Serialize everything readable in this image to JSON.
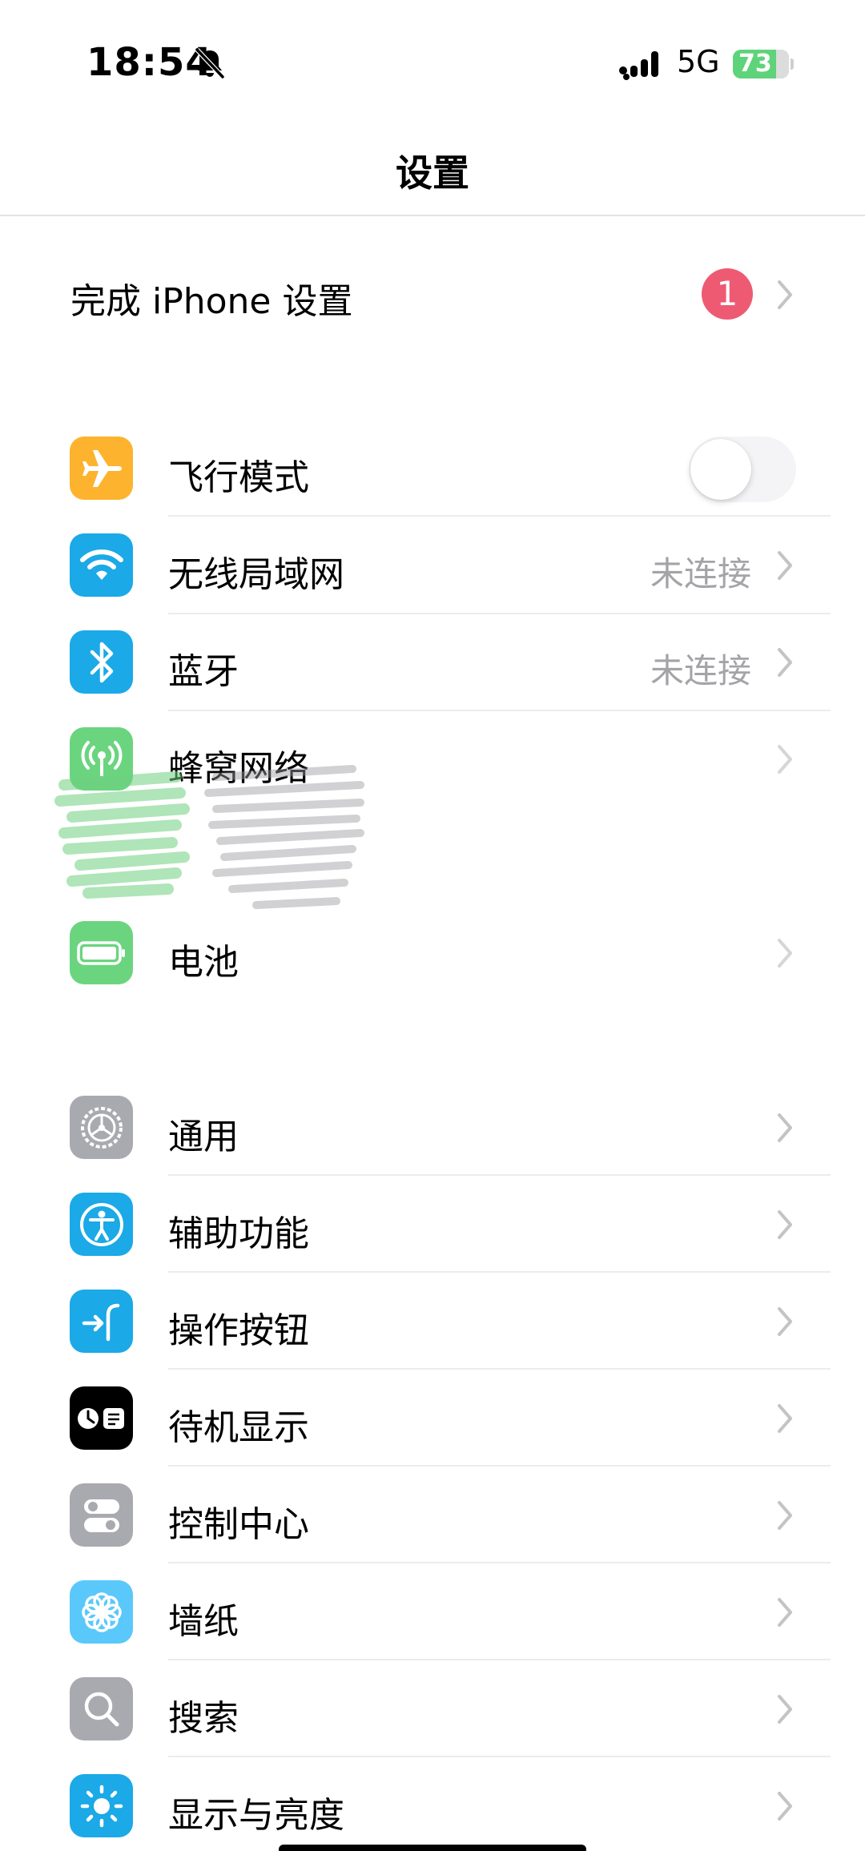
{
  "status_bar": {
    "time": "18:54",
    "network": "5G",
    "battery": "73"
  },
  "header": {
    "title": "设置"
  },
  "setup": {
    "label": "完成 iPhone 设置",
    "badge": "1"
  },
  "group1": [
    {
      "label": "飞行模式",
      "icon": "airplane-icon",
      "color": "#FDB32E",
      "toggle_on": false
    },
    {
      "label": "无线局域网",
      "value": "未连接",
      "icon": "wifi-icon",
      "color": "#1BA9E7"
    },
    {
      "label": "蓝牙",
      "value": "未连接",
      "icon": "bluetooth-icon",
      "color": "#1BA9E7"
    },
    {
      "label": "蜂窝网络",
      "icon": "cellular-icon",
      "color": "#6BD47F"
    },
    {
      "label": "电池",
      "icon": "battery-icon",
      "color": "#6BD47F"
    }
  ],
  "group2": [
    {
      "label": "通用",
      "icon": "gear-icon",
      "color": "#A9A9B0"
    },
    {
      "label": "辅助功能",
      "icon": "accessibility-icon",
      "color": "#1BA9E7"
    },
    {
      "label": "操作按钮",
      "icon": "action-button-icon",
      "color": "#1BA9E7"
    },
    {
      "label": "待机显示",
      "icon": "standby-icon",
      "color": "#000000"
    },
    {
      "label": "控制中心",
      "icon": "control-center-icon",
      "color": "#A9A9B0"
    },
    {
      "label": "墙纸",
      "icon": "wallpaper-icon",
      "color": "#5AC8FA"
    },
    {
      "label": "搜索",
      "icon": "search-icon",
      "color": "#A9A9B0"
    },
    {
      "label": "显示与亮度",
      "icon": "brightness-icon",
      "color": "#1BA9E7"
    }
  ]
}
